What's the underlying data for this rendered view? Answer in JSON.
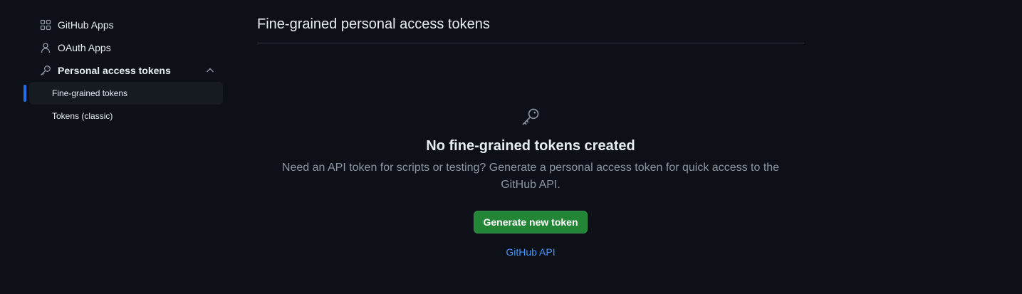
{
  "sidebar": {
    "items": [
      {
        "label": "GitHub Apps",
        "icon": "apps-grid-icon"
      },
      {
        "label": "OAuth Apps",
        "icon": "person-icon"
      },
      {
        "label": "Personal access tokens",
        "icon": "key-icon",
        "expanded": true
      }
    ],
    "sub_items": [
      {
        "label": "Fine-grained tokens",
        "active": true
      },
      {
        "label": "Tokens (classic)",
        "active": false
      }
    ]
  },
  "main": {
    "title": "Fine-grained personal access tokens"
  },
  "blankslate": {
    "icon": "key-icon",
    "heading": "No fine-grained tokens created",
    "description": "Need an API token for scripts or testing? Generate a personal access token for quick access to the GitHub API.",
    "button_label": "Generate new token",
    "link_label": "GitHub API"
  },
  "colors": {
    "background": "#0d1117",
    "accent": "#1f6feb",
    "primary_button": "#238636",
    "link": "#4493f8",
    "muted_text": "#8d96a0"
  }
}
